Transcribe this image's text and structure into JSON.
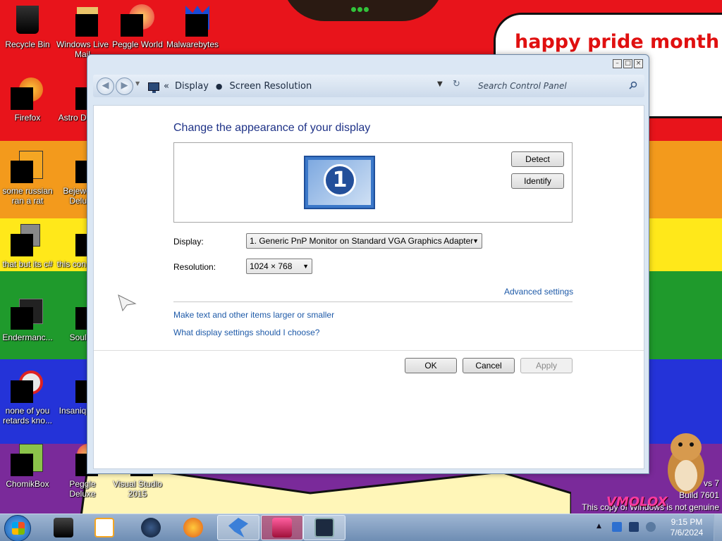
{
  "wallpaper": {
    "banner_text": "happy pride month",
    "watermark_line1": "vs 7",
    "watermark_line2": "Build 7601",
    "watermark_line3": "This copy of Windows is not genuine",
    "logo_text": "VMOLOX"
  },
  "desktop_icons": [
    {
      "label": "Recycle Bin",
      "icon": "recycle-bin-icon"
    },
    {
      "label": "Windows Live Mail",
      "icon": "windows-live-mail-icon"
    },
    {
      "label": "Peggle World",
      "icon": "peggle-world-icon"
    },
    {
      "label": "Malwarebytes",
      "icon": "malwarebytes-icon"
    },
    {
      "label": "Firefox",
      "icon": "firefox-icon"
    },
    {
      "label": "Astro Deluxe",
      "icon": "astro-deluxe-icon"
    },
    {
      "label": "some russian ran a rat",
      "icon": "generic-app-icon"
    },
    {
      "label": "Bejeweled Deluxe",
      "icon": "bejeweled-icon"
    },
    {
      "label": "that but its c#",
      "icon": "generic-file-icon"
    },
    {
      "label": "this con is fuc",
      "icon": "generic-file-icon"
    },
    {
      "label": "Endermanc...",
      "icon": "generic-app-icon"
    },
    {
      "label": "Soulse",
      "icon": "generic-app-icon"
    },
    {
      "label": "none of you retards kno...",
      "icon": "generic-app-icon"
    },
    {
      "label": "Insaniq Delu",
      "icon": "generic-app-icon"
    },
    {
      "label": "ChomikBox",
      "icon": "chomikbox-icon"
    },
    {
      "label": "Peggle Deluxe",
      "icon": "peggle-deluxe-icon"
    },
    {
      "label": "Visual Studio 2015",
      "icon": "visual-studio-icon"
    }
  ],
  "window": {
    "breadcrumb": [
      "Display",
      "Screen Resolution"
    ],
    "breadcrumb_overflow": "«",
    "search_placeholder": "Search Control Panel",
    "title": "Change the appearance of your display",
    "monitor_number": "1",
    "detect_label": "Detect",
    "identify_label": "Identify",
    "display_label": "Display:",
    "display_value": "1. Generic PnP Monitor on Standard VGA Graphics Adapter",
    "resolution_label": "Resolution:",
    "resolution_value": "1024 × 768",
    "advanced_link": "Advanced settings",
    "larger_link": "Make text and other items larger or smaller",
    "which_link": "What display settings should I choose?",
    "ok_label": "OK",
    "cancel_label": "Cancel",
    "apply_label": "Apply"
  },
  "taskbar": {
    "items": [
      {
        "icon": "black-app-icon",
        "active": false
      },
      {
        "icon": "media-player-icon",
        "active": false
      },
      {
        "icon": "globe-app-icon",
        "active": false
      },
      {
        "icon": "firefox-taskbar-icon",
        "active": false
      },
      {
        "icon": "bird-app-icon",
        "active": true
      },
      {
        "icon": "display-settings-icon",
        "active": true
      },
      {
        "icon": "monitor-app-icon",
        "active": true
      }
    ],
    "clock_time": "9:15 PM",
    "clock_date": "7/6/2024"
  },
  "colors": {
    "link": "#1e5aa8",
    "title": "#1e3287",
    "pride_text": "#e01010"
  }
}
